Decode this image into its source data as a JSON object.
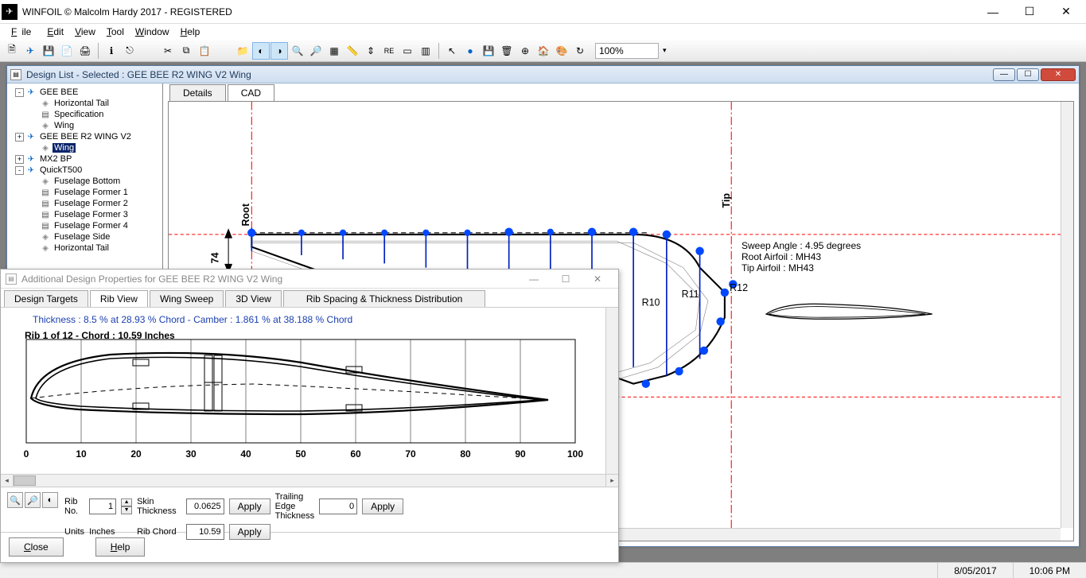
{
  "app": {
    "title": "WINFOIL © Malcolm Hardy 2017 - REGISTERED"
  },
  "menu": {
    "file": "File",
    "edit": "Edit",
    "view": "View",
    "tool": "Tool",
    "window": "Window",
    "help": "Help"
  },
  "toolbar": {
    "zoom": "100%"
  },
  "designlist": {
    "title": "Design List - Selected : GEE BEE R2 WING V2 Wing",
    "tabs": {
      "details": "Details",
      "cad": "CAD"
    },
    "tree": {
      "items": [
        {
          "indent": 0,
          "exp": "-",
          "icon": "plane",
          "label": "GEE BEE"
        },
        {
          "indent": 1,
          "exp": "",
          "icon": "gray",
          "label": "Horizontal Tail"
        },
        {
          "indent": 1,
          "exp": "",
          "icon": "doc",
          "label": "Specification"
        },
        {
          "indent": 1,
          "exp": "",
          "icon": "gray",
          "label": "Wing"
        },
        {
          "indent": 0,
          "exp": "+",
          "icon": "plane",
          "label": "GEE BEE R2 WING V2"
        },
        {
          "indent": 1,
          "exp": "",
          "icon": "gray",
          "label": "Wing",
          "sel": true
        },
        {
          "indent": 0,
          "exp": "+",
          "icon": "plane",
          "label": "MX2 BP"
        },
        {
          "indent": 0,
          "exp": "-",
          "icon": "plane",
          "label": "QuickT500"
        },
        {
          "indent": 1,
          "exp": "",
          "icon": "gray",
          "label": "Fuselage Bottom"
        },
        {
          "indent": 1,
          "exp": "",
          "icon": "doc",
          "label": "Fuselage Former 1"
        },
        {
          "indent": 1,
          "exp": "",
          "icon": "doc",
          "label": "Fuselage Former 2"
        },
        {
          "indent": 1,
          "exp": "",
          "icon": "doc",
          "label": "Fuselage Former 3"
        },
        {
          "indent": 1,
          "exp": "",
          "icon": "doc",
          "label": "Fuselage Former 4"
        },
        {
          "indent": 1,
          "exp": "",
          "icon": "gray",
          "label": "Fuselage Side"
        },
        {
          "indent": 1,
          "exp": "",
          "icon": "gray",
          "label": "Horizontal Tail"
        }
      ]
    },
    "cad": {
      "root_label": "Root",
      "tip_label": "Tip",
      "dim_value": "74",
      "ribs": {
        "r10": "R10",
        "r11": "R11",
        "r12": "R12"
      },
      "info": {
        "sweep": "Sweep Angle : 4.95 degrees",
        "root_af": "Root Airfoil : MH43",
        "tip_af": "Tip Airfoil   : MH43"
      }
    }
  },
  "props": {
    "title": "Additional Design Properties for GEE BEE R2 WING V2 Wing",
    "tabs": {
      "t1": "Design Targets",
      "t2": "Rib View",
      "t3": "Wing Sweep",
      "t4": "3D View",
      "t5": "Rib Spacing & Thickness Distribution"
    },
    "rib_info": "Thickness : 8.5 % at 28.93 % Chord - Camber : 1.861 % at 38.188 % Chord",
    "rib_header": "Rib 1 of 12 - Chord : 10.59 Inches",
    "controls": {
      "rib_no_label": "Rib\nNo.",
      "rib_no_value": "1",
      "units_label": "Units",
      "units_value": "Inches",
      "skin_label": "Skin\nThickness",
      "skin_value": "0.0625",
      "rib_chord_label": "Rib Chord",
      "rib_chord_value": "10.59",
      "te_label": "Trailing\nEdge\nThickness",
      "te_value": "0",
      "apply": "Apply"
    },
    "footer": {
      "close": "Close",
      "help": "Help"
    }
  },
  "status": {
    "date": "8/05/2017",
    "time": "10:06 PM"
  },
  "chart_data": {
    "type": "line",
    "title": "Rib 1 of 12 - Chord : 10.59 Inches",
    "xlabel": "",
    "ylabel": "",
    "xlim": [
      0,
      100
    ],
    "x_ticks": [
      0,
      10,
      20,
      30,
      40,
      50,
      60,
      70,
      80,
      90,
      100
    ],
    "annotation": "Thickness : 8.5 % at 28.93 % Chord - Camber : 1.861 % at 38.188 % Chord",
    "series": [
      {
        "name": "upper_surface",
        "x": [
          0,
          5,
          10,
          20,
          28.93,
          40,
          50,
          60,
          70,
          80,
          90,
          100
        ],
        "y": [
          0,
          3.8,
          5.0,
          6.5,
          7.0,
          6.7,
          6.0,
          5.0,
          3.9,
          2.7,
          1.5,
          0.2
        ]
      },
      {
        "name": "lower_surface",
        "x": [
          0,
          5,
          10,
          20,
          28.93,
          40,
          50,
          60,
          70,
          80,
          90,
          100
        ],
        "y": [
          0,
          -1.0,
          -1.3,
          -1.5,
          -1.5,
          -1.3,
          -1.1,
          -0.9,
          -0.7,
          -0.5,
          -0.3,
          -0.1
        ]
      },
      {
        "name": "camber_line",
        "x": [
          0,
          10,
          20,
          30,
          38.188,
          50,
          60,
          70,
          80,
          90,
          100
        ],
        "y": [
          0,
          1.0,
          1.5,
          1.8,
          1.861,
          1.7,
          1.4,
          1.1,
          0.8,
          0.4,
          0.05
        ]
      }
    ]
  }
}
